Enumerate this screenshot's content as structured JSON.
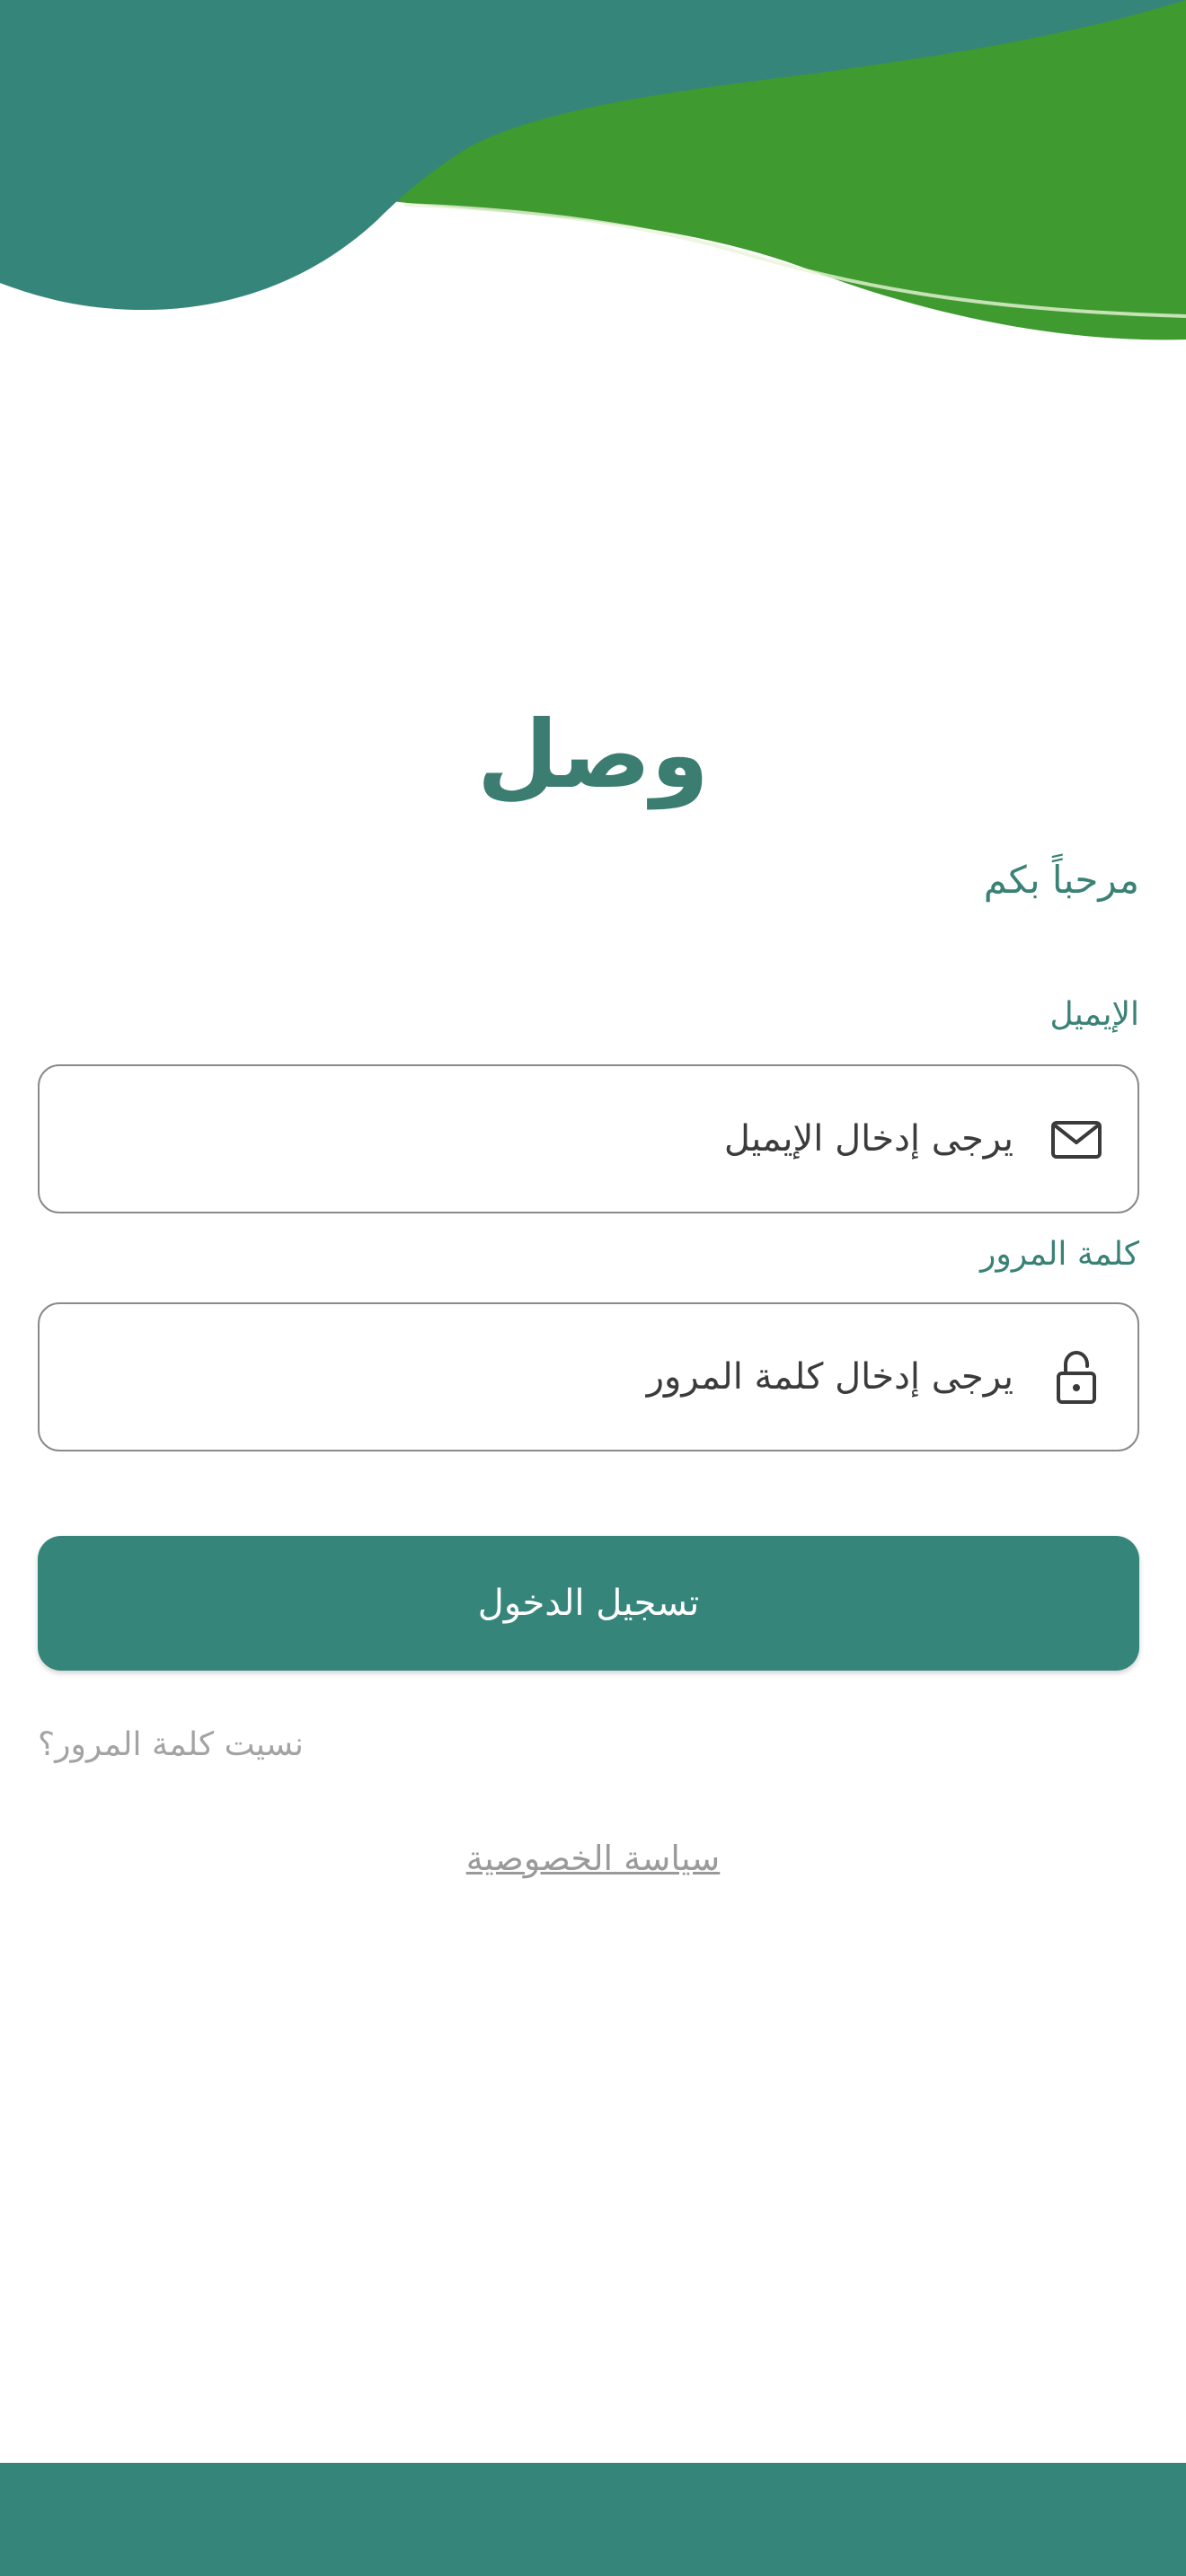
{
  "app": {
    "title": "وصل",
    "welcome": "مرحباً بكم"
  },
  "form": {
    "email_label": "الإيميل",
    "email_placeholder": "يرجى إدخال الإيميل",
    "password_label": "كلمة المرور",
    "password_placeholder": "يرجى إدخال كلمة المرور",
    "login_button": "تسجيل الدخول",
    "forgot_password": "نسيت كلمة المرور؟",
    "privacy_policy": "سياسة الخصوصية"
  },
  "icons": {
    "email": "mail-icon",
    "password": "lock-icon"
  },
  "colors": {
    "primary": "#36857a",
    "secondary": "#3f9a2f",
    "background": "#ffffff"
  }
}
